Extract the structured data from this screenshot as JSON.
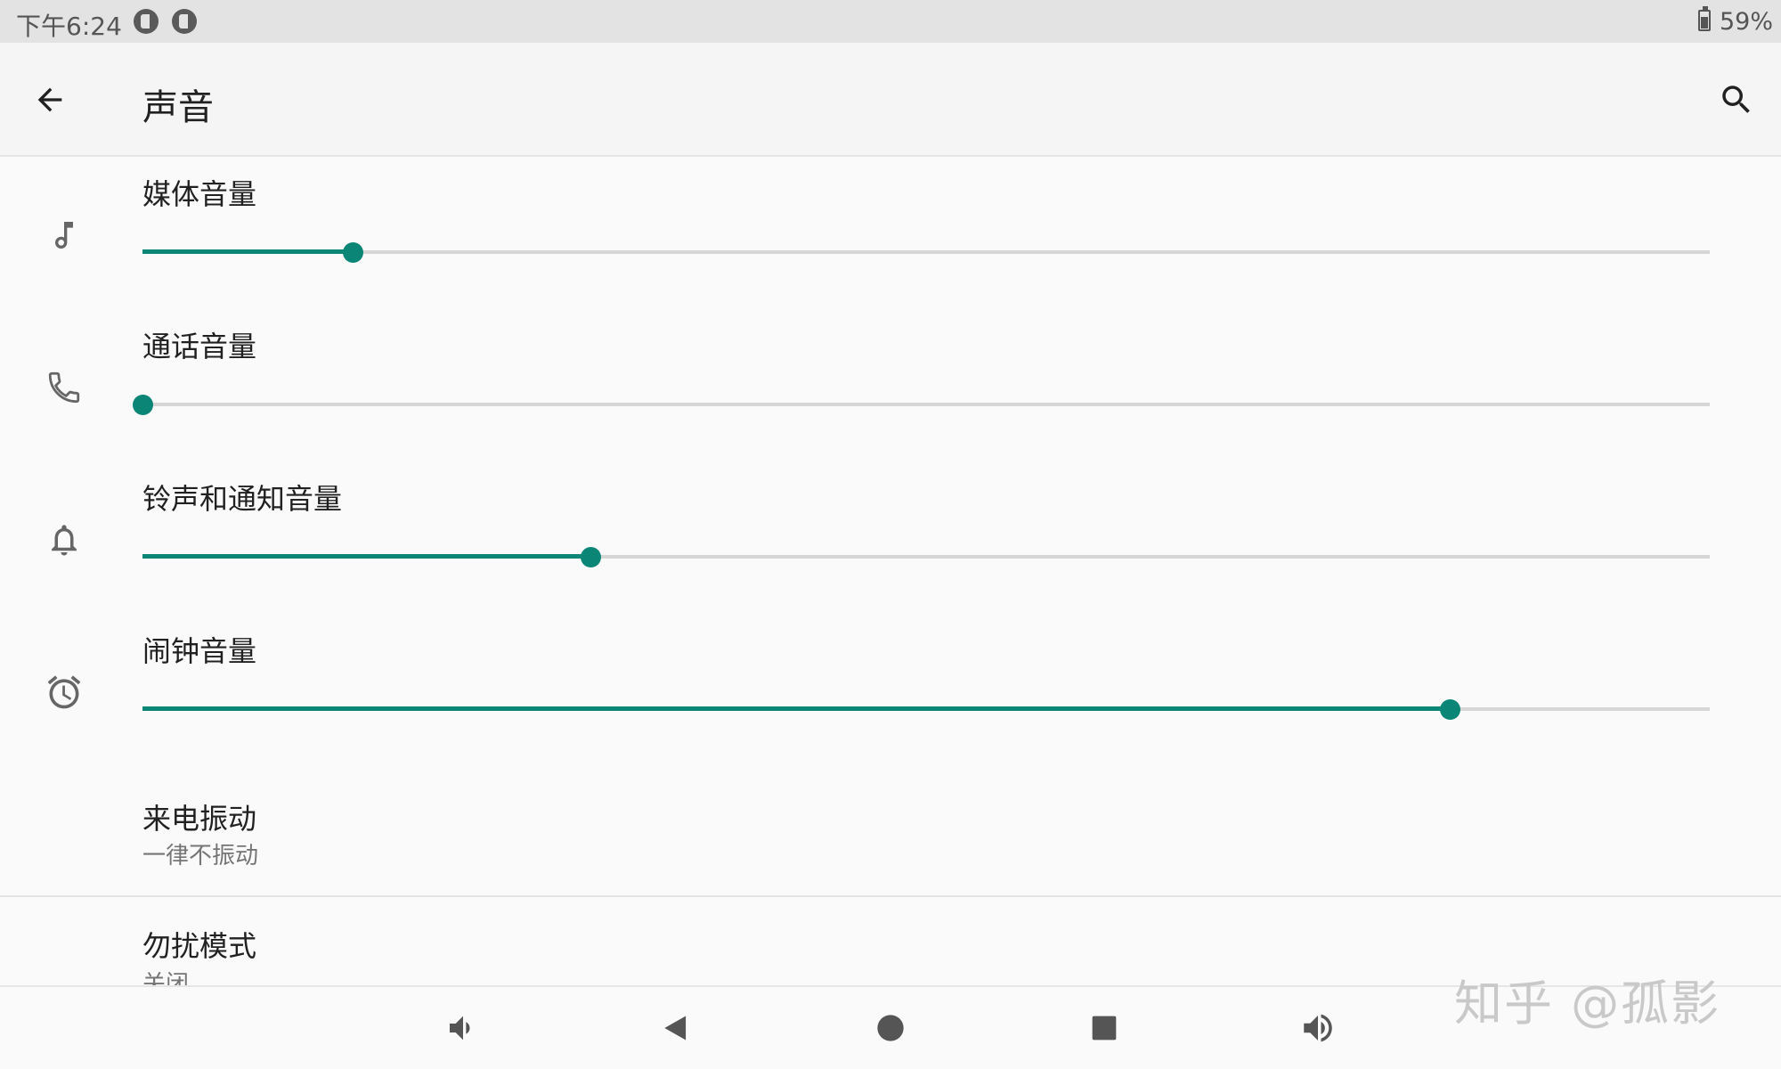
{
  "status_bar": {
    "time": "下午6:24",
    "battery": "59%"
  },
  "app_bar": {
    "title": "声音"
  },
  "volumes": [
    {
      "label": "媒体音量",
      "icon": "music-note-icon",
      "level": 0.134
    },
    {
      "label": "通话音量",
      "icon": "phone-icon",
      "level": 0.0
    },
    {
      "label": "铃声和通知音量",
      "icon": "bell-icon",
      "level": 0.286
    },
    {
      "label": "闹钟音量",
      "icon": "alarm-clock-icon",
      "level": 0.834
    }
  ],
  "prefs": {
    "vibrate": {
      "title": "来电振动",
      "summary": "一律不振动"
    },
    "dnd": {
      "title": "勿扰模式",
      "summary": "关闭"
    }
  },
  "watermark": "知乎 @孤影",
  "colors": {
    "accent": "#0a8576",
    "track": "#d6d6d6",
    "background": "#fafafa"
  }
}
